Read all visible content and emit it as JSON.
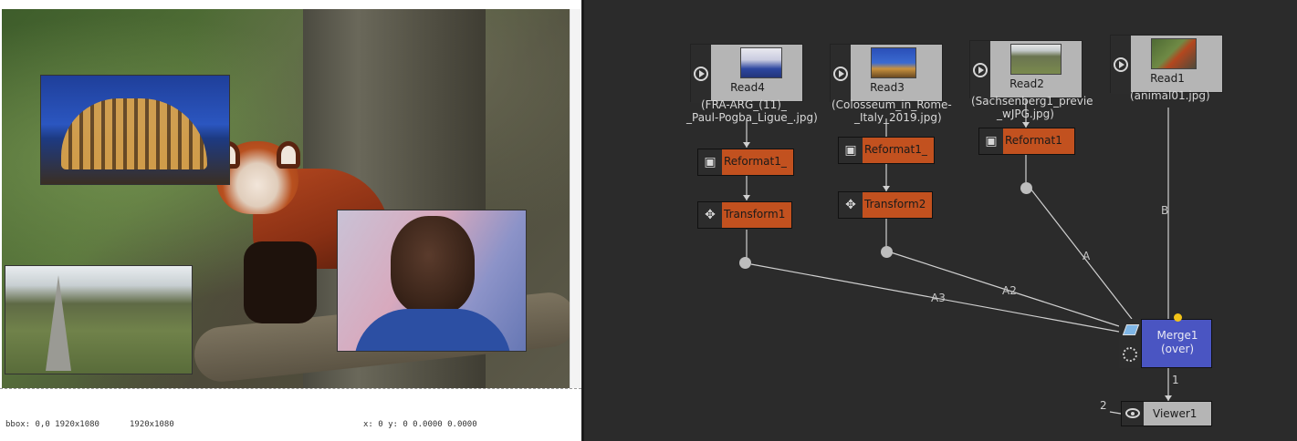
{
  "viewer": {
    "info": {
      "bbox": "bbox: 0,0 1920x1080",
      "format": "1920x1080",
      "coords": "x: 0 y: 0  0.0000 0.0000"
    }
  },
  "nodegraph": {
    "read_nodes": [
      {
        "label": "Read4",
        "subtitle_1": "(FRA-ARG_(11)_",
        "subtitle_2": "_Paul-Pogba_Ligue_.jpg)"
      },
      {
        "label": "Read3",
        "subtitle_1": "(Colosseum_in_Rome-",
        "subtitle_2": "_Italy_2019.jpg)"
      },
      {
        "label": "Read2",
        "subtitle_1": "(Sachsenberg1_previe",
        "subtitle_2": "_wJPG.jpg)"
      },
      {
        "label": "Read1",
        "subtitle_1": "(animal01.jpg)",
        "subtitle_2": ""
      }
    ],
    "reformat_nodes": [
      {
        "label": "Reformat1_"
      },
      {
        "label": "Reformat1_"
      },
      {
        "label": "Reformat1"
      }
    ],
    "transform_nodes": [
      {
        "label": "Transform1"
      },
      {
        "label": "Transform2"
      }
    ],
    "merge": {
      "label_1": "Merge1",
      "label_2": "(over)"
    },
    "viewer_node": {
      "label": "Viewer1",
      "input_1": "1",
      "input_2": "2"
    },
    "edge_labels": {
      "a3": "A3",
      "a2": "A2",
      "a": "A",
      "b": "B"
    },
    "colors": {
      "read": "#b5b5b5",
      "op": "#c2511f",
      "merge": "#4a55c2",
      "background": "#2b2b2b"
    }
  }
}
